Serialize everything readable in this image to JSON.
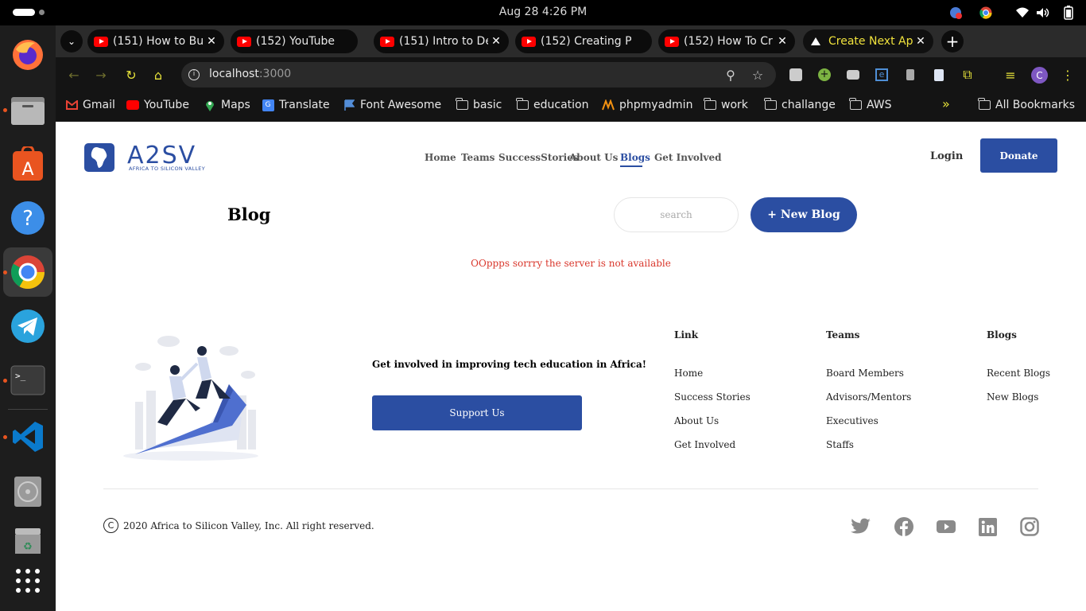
{
  "system": {
    "clock": "Aug 28   4:26 PM"
  },
  "browser": {
    "tabs": [
      {
        "title": "(151) How to Bu",
        "icon": "youtube-icon"
      },
      {
        "title": "(152) YouTube",
        "icon": "youtube-icon"
      },
      {
        "title": "(151) Intro to De",
        "icon": "youtube-icon"
      },
      {
        "title": "(152) Creating P",
        "icon": "youtube-icon"
      },
      {
        "title": "(152) How To Cr",
        "icon": "youtube-icon"
      },
      {
        "title": "Create Next App",
        "icon": "triangle-icon"
      }
    ],
    "url_host": "localhost",
    "url_port": ":3000",
    "bookmarks": [
      {
        "label": "Gmail",
        "icon": "gmail-icon"
      },
      {
        "label": "YouTube",
        "icon": "youtube-icon"
      },
      {
        "label": "Maps",
        "icon": "maps-icon"
      },
      {
        "label": "Translate",
        "icon": "translate-icon"
      },
      {
        "label": "Font Awesome",
        "icon": "flag-icon"
      },
      {
        "label": "basic",
        "icon": "folder-icon"
      },
      {
        "label": "education",
        "icon": "folder-icon"
      },
      {
        "label": "phpmyadmin",
        "icon": "phpmyadmin-icon"
      },
      {
        "label": "work",
        "icon": "folder-icon"
      },
      {
        "label": "challange",
        "icon": "folder-icon"
      },
      {
        "label": "AWS",
        "icon": "folder-icon"
      }
    ],
    "more_bookmarks": "»",
    "all_bookmarks": "All Bookmarks",
    "profile_initial": "C"
  },
  "site": {
    "logo_text": "A2SV",
    "logo_sub": "AFRICA TO SILICON VALLEY",
    "nav": [
      "Home",
      "Teams",
      "SuccessStories",
      "About Us",
      "Blogs",
      "Get Involved"
    ],
    "active_nav": "Blogs",
    "login": "Login",
    "donate": "Donate"
  },
  "blog": {
    "title": "Blog",
    "search_placeholder": "search",
    "new_blog": "+ New Blog",
    "error": "OOppps sorrry the server is not available"
  },
  "footer": {
    "cta": "Get involved in improving tech education in Africa!",
    "support": "Support Us",
    "columns": [
      {
        "heading": "Link",
        "links": [
          "Home",
          "Success Stories",
          "About Us",
          "Get Involved"
        ]
      },
      {
        "heading": "Teams",
        "links": [
          "Board Members",
          "Advisors/Mentors",
          "Executives",
          "Staffs"
        ]
      },
      {
        "heading": "Blogs",
        "links": [
          "Recent Blogs",
          "New Blogs"
        ]
      }
    ],
    "copyright": "2020 Africa to Silicon Valley, Inc. All right reserved.",
    "social": [
      "twitter-icon",
      "facebook-icon",
      "youtube-icon",
      "linkedin-icon",
      "instagram-icon"
    ]
  },
  "colors": {
    "brand": "#2b4ea2",
    "error": "#d9362b",
    "active_tab_text": "#f0e23c"
  }
}
